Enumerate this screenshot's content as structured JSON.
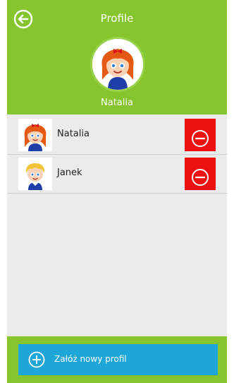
{
  "header": {
    "title": "Profile",
    "back_icon": "back-arrow-icon",
    "current_profile_name": "Natalia",
    "background_color": "#86c52d"
  },
  "profiles": [
    {
      "name": "Natalia",
      "avatar": "girl-red-hair-avatar",
      "delete_icon": "minus-circle-icon"
    },
    {
      "name": "Janek",
      "avatar": "boy-blond-hair-avatar",
      "delete_icon": "minus-circle-icon"
    }
  ],
  "footer": {
    "new_profile_label": "Załóż nowy profil",
    "plus_icon": "plus-circle-icon",
    "button_color": "#1ea6d8"
  },
  "colors": {
    "delete": "#ee1111",
    "list_background": "#ebebeb"
  }
}
